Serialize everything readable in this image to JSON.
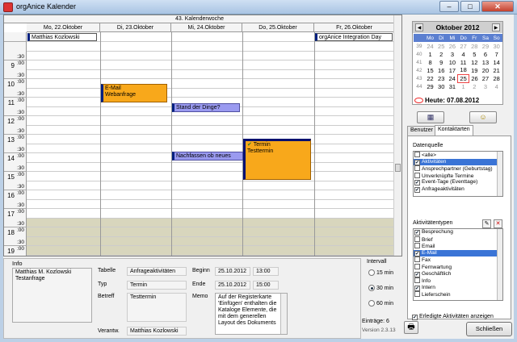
{
  "window": {
    "title": "orgAnice Kalender",
    "buttons": [
      "–",
      "□",
      "✕"
    ]
  },
  "calendar": {
    "week_label": "43. Kalenderwoche",
    "days": [
      "Mo, 22.Oktober",
      "Di, 23.Oktober",
      "Mi, 24.Oktober",
      "Do, 25.Oktober",
      "Fr, 26.Oktober"
    ],
    "hours": [
      {
        "label": "",
        "m1": ":30",
        "m2": ""
      },
      {
        "label": "9",
        "m1": ":00",
        "m2": ":30"
      },
      {
        "label": "10",
        "m1": ":00",
        "m2": ":30"
      },
      {
        "label": "11",
        "m1": ":00",
        "m2": ":30"
      },
      {
        "label": "12",
        "m1": ":00",
        "m2": ":30"
      },
      {
        "label": "13",
        "m1": ":00",
        "m2": ":30"
      },
      {
        "label": "14",
        "m1": ":00",
        "m2": ":30"
      },
      {
        "label": "15",
        "m1": ":00",
        "m2": ":30"
      },
      {
        "label": "16",
        "m1": ":00",
        "m2": ":30"
      },
      {
        "label": "17",
        "m1": ":00",
        "m2": ":30"
      },
      {
        "label": "18",
        "m1": ":00",
        "m2": ":30"
      },
      {
        "label": "19",
        "m1": ":00",
        "m2": ":30"
      }
    ],
    "appointments": {
      "mo_allday": "Matthias Kozlowski",
      "fr_allday": "orgAnice Integration Day",
      "di_email_line1": "E-Mail",
      "di_email_line2": "Webanfrage",
      "mi_stand": "Stand der Dinge?",
      "mi_nachfassen": "Nachfassen ob neues",
      "do_termin_line1": "Termin",
      "do_termin_line2": "Testtermin"
    }
  },
  "info": {
    "title": "Info",
    "contact": "Matthias M. Kozlowski\nTestanfrage",
    "tabelle_label": "Tabelle",
    "tabelle_value": "Anfrageaktivitäten",
    "typ_label": "Typ",
    "typ_value": "Termin",
    "betreff_label": "Betreff",
    "betreff_value": "Testtermin",
    "verantw_label": "Verantw.",
    "verantw_value": "Matthias Kozlowski",
    "beginn_label": "Beginn",
    "beginn_date": "25.10.2012",
    "beginn_time": "13:00",
    "ende_label": "Ende",
    "ende_date": "25.10.2012",
    "ende_time": "15:00",
    "memo_label": "Memo",
    "memo_text": "Auf der Registerkarte 'Einfügen' enthalten die Kataloge Elemente, die mit dem generellen Layout des Dokuments"
  },
  "interval": {
    "label": "Intervall",
    "options": [
      "15 min",
      "30 min",
      "60 min"
    ],
    "selected": "30 min"
  },
  "footer": {
    "entries": "Einträge: 6",
    "version": "Version 2.3.13",
    "close_label": "Schließen"
  },
  "minical": {
    "month": "Oktober 2012",
    "weekday_headers": [
      "Mo",
      "Di",
      "Mi",
      "Do",
      "Fr",
      "Sa",
      "So"
    ],
    "weeks": [
      {
        "wk": "39",
        "days": [
          "24",
          "25",
          "26",
          "27",
          "28",
          "29",
          "30"
        ]
      },
      {
        "wk": "40",
        "days": [
          "1",
          "2",
          "3",
          "4",
          "5",
          "6",
          "7"
        ]
      },
      {
        "wk": "41",
        "days": [
          "8",
          "9",
          "10",
          "11",
          "12",
          "13",
          "14"
        ]
      },
      {
        "wk": "42",
        "days": [
          "15",
          "16",
          "17",
          "18",
          "19",
          "20",
          "21"
        ]
      },
      {
        "wk": "43",
        "days": [
          "22",
          "23",
          "24",
          "25",
          "26",
          "27",
          "28"
        ]
      },
      {
        "wk": "44",
        "days": [
          "29",
          "30",
          "31",
          "1",
          "2",
          "3",
          "4"
        ]
      }
    ],
    "heute": "Heute: 07.08.2012"
  },
  "tabs": [
    "Benutzer",
    "Kontaktarten"
  ],
  "datenquelle": {
    "label": "Datenquelle",
    "items": [
      {
        "label": "<alle>",
        "checked": false,
        "selected": false
      },
      {
        "label": "Aktivitäten",
        "checked": true,
        "selected": true
      },
      {
        "label": "Ansprechpartner (Geburtstag)",
        "checked": false,
        "selected": false
      },
      {
        "label": "Unverknüpfte Termine",
        "checked": false,
        "selected": false
      },
      {
        "label": "Event-Tage (Eventtage)",
        "checked": true,
        "selected": false
      },
      {
        "label": "Anfrageaktivitäten",
        "checked": true,
        "selected": false
      }
    ]
  },
  "aktivitaetentypen": {
    "label": "Aktivitätentypen",
    "items": [
      {
        "label": "Besprechung",
        "checked": true,
        "selected": false
      },
      {
        "label": "Brief",
        "checked": false,
        "selected": false
      },
      {
        "label": "Email",
        "checked": false,
        "selected": false
      },
      {
        "label": "E-Mail",
        "checked": true,
        "selected": true
      },
      {
        "label": "Fax",
        "checked": false,
        "selected": false
      },
      {
        "label": "Fernwartung",
        "checked": false,
        "selected": false
      },
      {
        "label": "Geschäftlich",
        "checked": true,
        "selected": false
      },
      {
        "label": "Info",
        "checked": false,
        "selected": false
      },
      {
        "label": "Intern",
        "checked": true,
        "selected": false
      },
      {
        "label": "Lieferschein",
        "checked": false,
        "selected": false
      }
    ]
  },
  "erledigt_label": "Erledigte Aktivitäten anzeigen",
  "colors": {
    "orange": "#f8a81b",
    "violet": "#9a9af0",
    "offhours": "#d8d6bd",
    "selected": "#3a74d6"
  }
}
